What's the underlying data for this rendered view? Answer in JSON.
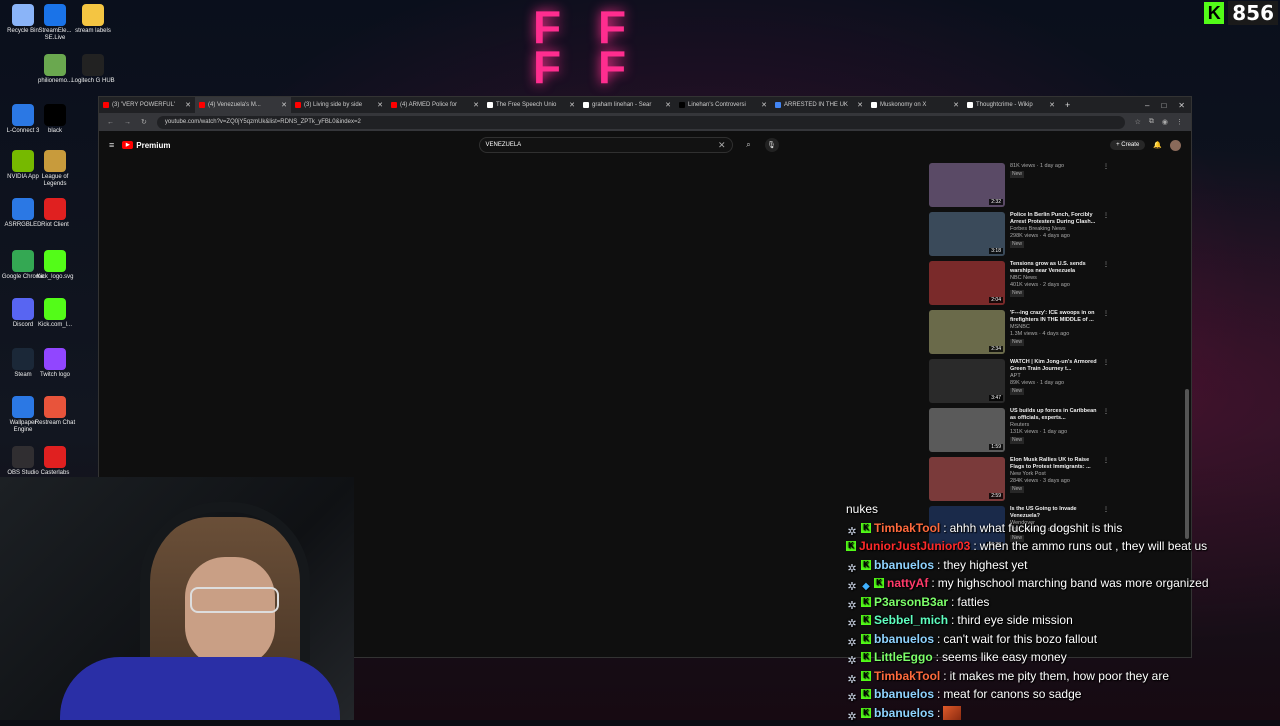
{
  "kick_overlay": {
    "viewer_count": "856"
  },
  "desktop": {
    "icons": [
      {
        "label": "Recycle Bin",
        "color": "#8ab4f8"
      },
      {
        "label": "StreamEle... SE.Live",
        "color": "#1a73e8"
      },
      {
        "label": "stream labels",
        "color": "#f4c542"
      },
      {
        "label": "philionemo...",
        "color": "#6aa84f"
      },
      {
        "label": "Logitech G HUB",
        "color": "#222222"
      },
      {
        "label": "L-Connect 3",
        "color": "#2b78e4"
      },
      {
        "label": "black",
        "color": "#000000"
      },
      {
        "label": "NVIDIA App",
        "color": "#76b900"
      },
      {
        "label": "League of Legends",
        "color": "#c89b3c"
      },
      {
        "label": "ASRRGBLED",
        "color": "#2b78e4"
      },
      {
        "label": "Riot Client",
        "color": "#e02020"
      },
      {
        "label": "Google Chrome",
        "color": "#34a853"
      },
      {
        "label": "Kick_logo.svg",
        "color": "#53fc18"
      },
      {
        "label": "Discord",
        "color": "#5865f2"
      },
      {
        "label": "Kick.com_l...",
        "color": "#53fc18"
      },
      {
        "label": "Steam",
        "color": "#1b2838"
      },
      {
        "label": "Twitch logo",
        "color": "#9146ff"
      },
      {
        "label": "Wallpaper Engine",
        "color": "#2b78e4"
      },
      {
        "label": "Restream Chat",
        "color": "#e8543b"
      },
      {
        "label": "OBS Studio",
        "color": "#302e31"
      },
      {
        "label": "Casterlabs",
        "color": "#e02020"
      }
    ]
  },
  "browser": {
    "tabs": [
      {
        "label": "(3) 'VERY POWERFUL'",
        "fav": "#ff0000"
      },
      {
        "label": "(4) Venezuela's M...",
        "fav": "#ff0000",
        "active": true
      },
      {
        "label": "(3) Living side by side",
        "fav": "#ff0000"
      },
      {
        "label": "(4) ARMED Police for",
        "fav": "#ff0000"
      },
      {
        "label": "The Free Speech Unio",
        "fav": "#ffffff"
      },
      {
        "label": "graham linehan - Sear",
        "fav": "#ffffff"
      },
      {
        "label": "Linehan's Controversi",
        "fav": "#000000"
      },
      {
        "label": "ARRESTED IN THE UK",
        "fav": "#4285f4"
      },
      {
        "label": "Muskonomy on X",
        "fav": "#ffffff"
      },
      {
        "label": "Thoughtcrime - Wikip",
        "fav": "#ffffff"
      }
    ],
    "url": "youtube.com/watch?v=ZQ0jY5qzmUk&list=RDNS_ZPTk_yFBL0&index=2",
    "logo_label": "Premium",
    "search_value": "VENEZUELA",
    "create_label": "Create",
    "notification_count": "9+"
  },
  "recommendations": [
    {
      "title": "",
      "channel": "",
      "views": "81K views · 1 day ago",
      "duration": "2:32",
      "badge": "New",
      "color": "#5a4a66"
    },
    {
      "title": "Police In Berlin Punch, Forcibly Arrest Protesters During Clash...",
      "channel": "Forbes Breaking News",
      "views": "298K views · 4 days ago",
      "duration": "3:18",
      "badge": "New",
      "color": "#3a4a5a"
    },
    {
      "title": "Tensions grow as U.S. sends warships near Venezuela",
      "channel": "NBC News",
      "views": "401K views · 2 days ago",
      "duration": "2:04",
      "badge": "New",
      "color": "#7a2a2a"
    },
    {
      "title": "'F---ing crazy': ICE swoops in on firefighters IN THE MIDDLE of ...",
      "channel": "MSNBC",
      "views": "1.3M views · 4 days ago",
      "duration": "2:34",
      "badge": "New",
      "color": "#6a6a4a"
    },
    {
      "title": "WATCH | Kim Jong-un's Armored Green Train Journey t...",
      "channel": "APT",
      "views": "89K views · 1 day ago",
      "duration": "3:47",
      "badge": "New",
      "color": "#2a2a2a"
    },
    {
      "title": "US builds up forces in Caribbean as officials, experts...",
      "channel": "Reuters",
      "views": "131K views · 1 day ago",
      "duration": "1:59",
      "badge": "New",
      "color": "#5a5a5a"
    },
    {
      "title": "Elon Musk Rallies UK to Raise Flags to Protest Immigrants: ...",
      "channel": "New York Post",
      "views": "284K views · 3 days ago",
      "duration": "2:59",
      "badge": "New",
      "color": "#7a3a3a"
    },
    {
      "title": "Is the US Going to Invade Venezuela?",
      "channel": "Wendover",
      "views": "481K views · 3 days ago",
      "duration": "12:38",
      "badge": "New",
      "color": "#1a2a4a"
    }
  ],
  "chat": {
    "messages": [
      {
        "user": "",
        "color": "#ffffff",
        "text": "nukes",
        "badges": []
      },
      {
        "user": "TimbakTool",
        "color": "#ff6a3d",
        "text": "ahhh what fucking dogshit is this",
        "badges": [
          "gear",
          "k"
        ]
      },
      {
        "user": "JuniorJustJunior03",
        "color": "#ff2a2a",
        "text": "when the ammo runs out , they will beat us",
        "badges": [
          "k"
        ]
      },
      {
        "user": "bbanuelos",
        "color": "#8fd3ff",
        "text": "they highest yet",
        "badges": [
          "gear",
          "k"
        ]
      },
      {
        "user": "nattyAf",
        "color": "#ff3a6a",
        "text": "my highschool marching band was more organized",
        "badges": [
          "gear",
          "gem",
          "k"
        ]
      },
      {
        "user": "P3arsonB3ar",
        "color": "#7dff6a",
        "text": "fatties",
        "badges": [
          "gear",
          "k"
        ]
      },
      {
        "user": "Sebbel_mich",
        "color": "#5fffc0",
        "text": "third eye side mission",
        "badges": [
          "gear",
          "k"
        ]
      },
      {
        "user": "bbanuelos",
        "color": "#8fd3ff",
        "text": "can't wait for this bozo fallout",
        "badges": [
          "gear",
          "k"
        ]
      },
      {
        "user": "LittleEggo",
        "color": "#7dff6a",
        "text": "seems like easy money",
        "badges": [
          "gear",
          "k"
        ]
      },
      {
        "user": "TimbakTool",
        "color": "#ff6a3d",
        "text": "it makes me pity them, how poor they are",
        "badges": [
          "gear",
          "k"
        ]
      },
      {
        "user": "bbanuelos",
        "color": "#8fd3ff",
        "text": "meat for canons so sadge",
        "badges": [
          "gear",
          "k"
        ]
      },
      {
        "user": "bbanuelos",
        "color": "#8fd3ff",
        "text": "",
        "badges": [
          "gear",
          "k"
        ],
        "emote": true
      }
    ]
  }
}
